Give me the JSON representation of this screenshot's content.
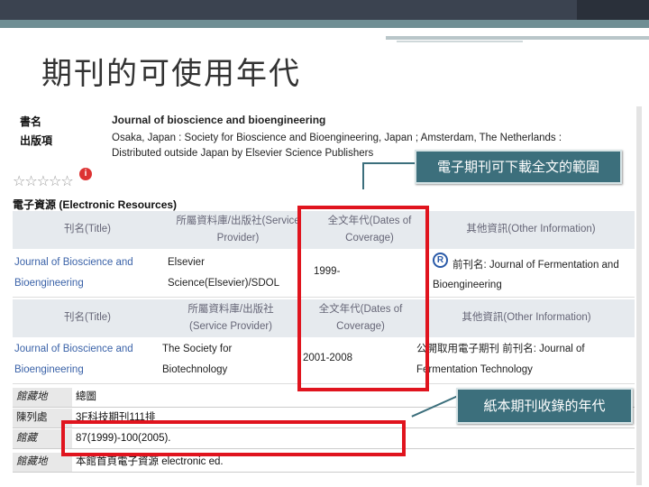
{
  "slide": {
    "title": "期刊的可使用年代"
  },
  "record": {
    "title_label": "書名",
    "title_value": "Journal of bioscience and bioengineering",
    "publisher_label": "出版項",
    "publisher_line1": "Osaka, Japan : Society for Bioscience and Bioengineering, Japan ; Amsterdam, The Netherlands :",
    "publisher_line2": "Distributed outside Japan by Elsevier Science Publishers"
  },
  "rating": {
    "stars": "☆☆☆☆☆",
    "info": "i"
  },
  "electronic": {
    "section_title": "電子資源 (Electronic Resources)",
    "table1": {
      "headers": [
        "刊名(Title)",
        "所屬資料庫/出版社(Service Provider)",
        "全文年代(Dates of Coverage)",
        "其他資訊(Other Information)"
      ],
      "header_lines": {
        "provider": [
          "所屬資料庫/出版社(Service",
          "Provider)"
        ],
        "coverage": [
          "全文年代(Dates of",
          "Coverage)"
        ]
      },
      "row": {
        "title_lines": [
          "Journal of Bioscience and",
          "Bioengineering"
        ],
        "provider_lines": [
          "Elsevier",
          "Science(Elsevier)/SDOL"
        ],
        "coverage": "1999-",
        "other_icon": "R",
        "other_lines": [
          "前刊名: Journal of Fermentation and",
          "Bioengineering"
        ]
      }
    },
    "table2": {
      "headers": {
        "title": "刊名(Title)",
        "provider": [
          "所屬資料庫/出版社",
          "(Service Provider)"
        ],
        "coverage": [
          "全文年代(Dates of",
          "Coverage)"
        ],
        "other": "其他資訊(Other Information)"
      },
      "row": {
        "title_lines": [
          "Journal of Bioscience and",
          "Bioengineering"
        ],
        "provider_lines": [
          "The Society for",
          "Biotechnology"
        ],
        "coverage": "2001-2008",
        "other_lines": [
          "公開取用電子期刊 前刊名: Journal of",
          "Fermentation Technology"
        ]
      }
    }
  },
  "holdings": {
    "rows": [
      {
        "label": "館藏地",
        "value": "總圖"
      },
      {
        "label": "陳列處",
        "value": "3F科技期刊111排"
      },
      {
        "label": "館藏",
        "value": "87(1999)-100(2005)."
      },
      {
        "label": "館藏地",
        "value": "本館首頁電子資源   electronic ed."
      }
    ]
  },
  "annotations": {
    "callout1": "電子期刊可下載全文的範圍",
    "callout2": "紙本期刊收錄的年代",
    "highlight_color": "#e0141e",
    "callout_color": "#3c6f7c"
  }
}
